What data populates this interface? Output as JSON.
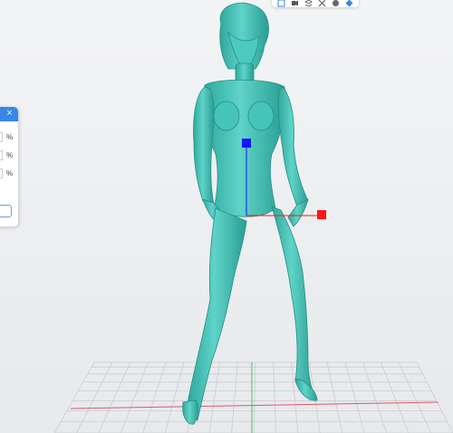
{
  "viewport": {
    "model_color": "#3cbcb1",
    "grid_color": "#c7c9cd",
    "x_axis_color": "#e0566b",
    "y_axis_color": "#49c26a",
    "gizmo_z_color": "#1414ff",
    "gizmo_x_color": "#ff1414"
  },
  "toolbar": {
    "buttons": [
      {
        "name": "view-cube-icon"
      },
      {
        "name": "camera-view-icon"
      },
      {
        "name": "layers-icon"
      },
      {
        "name": "cut-view-icon"
      },
      {
        "name": "shading-sphere-icon"
      },
      {
        "name": "material-icon"
      }
    ]
  },
  "scale_panel": {
    "close_icon": "×",
    "rows": [
      {
        "unit": "%"
      },
      {
        "unit": "%"
      },
      {
        "unit": "%"
      }
    ]
  }
}
